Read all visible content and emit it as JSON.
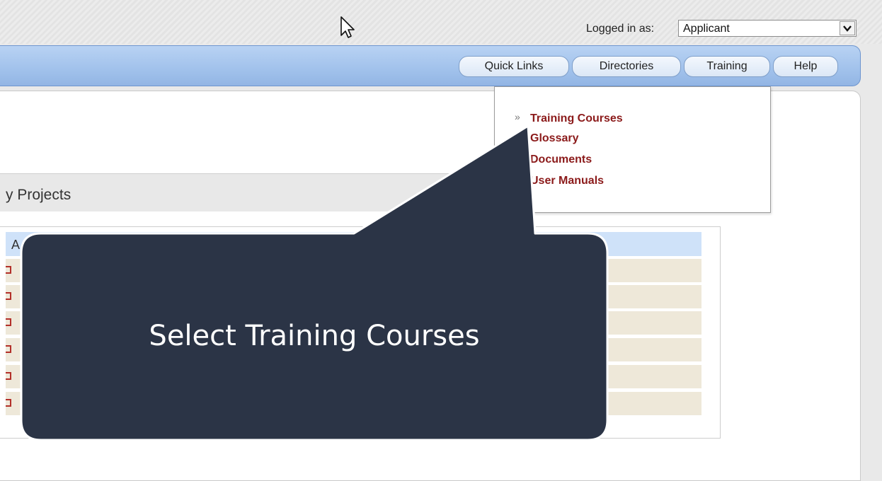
{
  "header": {
    "login_label": "Logged in as:",
    "role_value": "Applicant"
  },
  "nav": {
    "items": [
      {
        "label": "Quick Links"
      },
      {
        "label": "Directories"
      },
      {
        "label": "Training"
      },
      {
        "label": "Help"
      }
    ]
  },
  "training_menu": {
    "items": [
      {
        "label": "Training Courses"
      },
      {
        "label": "Glossary"
      },
      {
        "label": "Documents"
      },
      {
        "label": "User Manuals"
      }
    ]
  },
  "projects": {
    "title_partial": "y Projects",
    "header_partial": "A"
  },
  "callout": {
    "text": "Select Training Courses",
    "fill_color": "#2b3446"
  }
}
